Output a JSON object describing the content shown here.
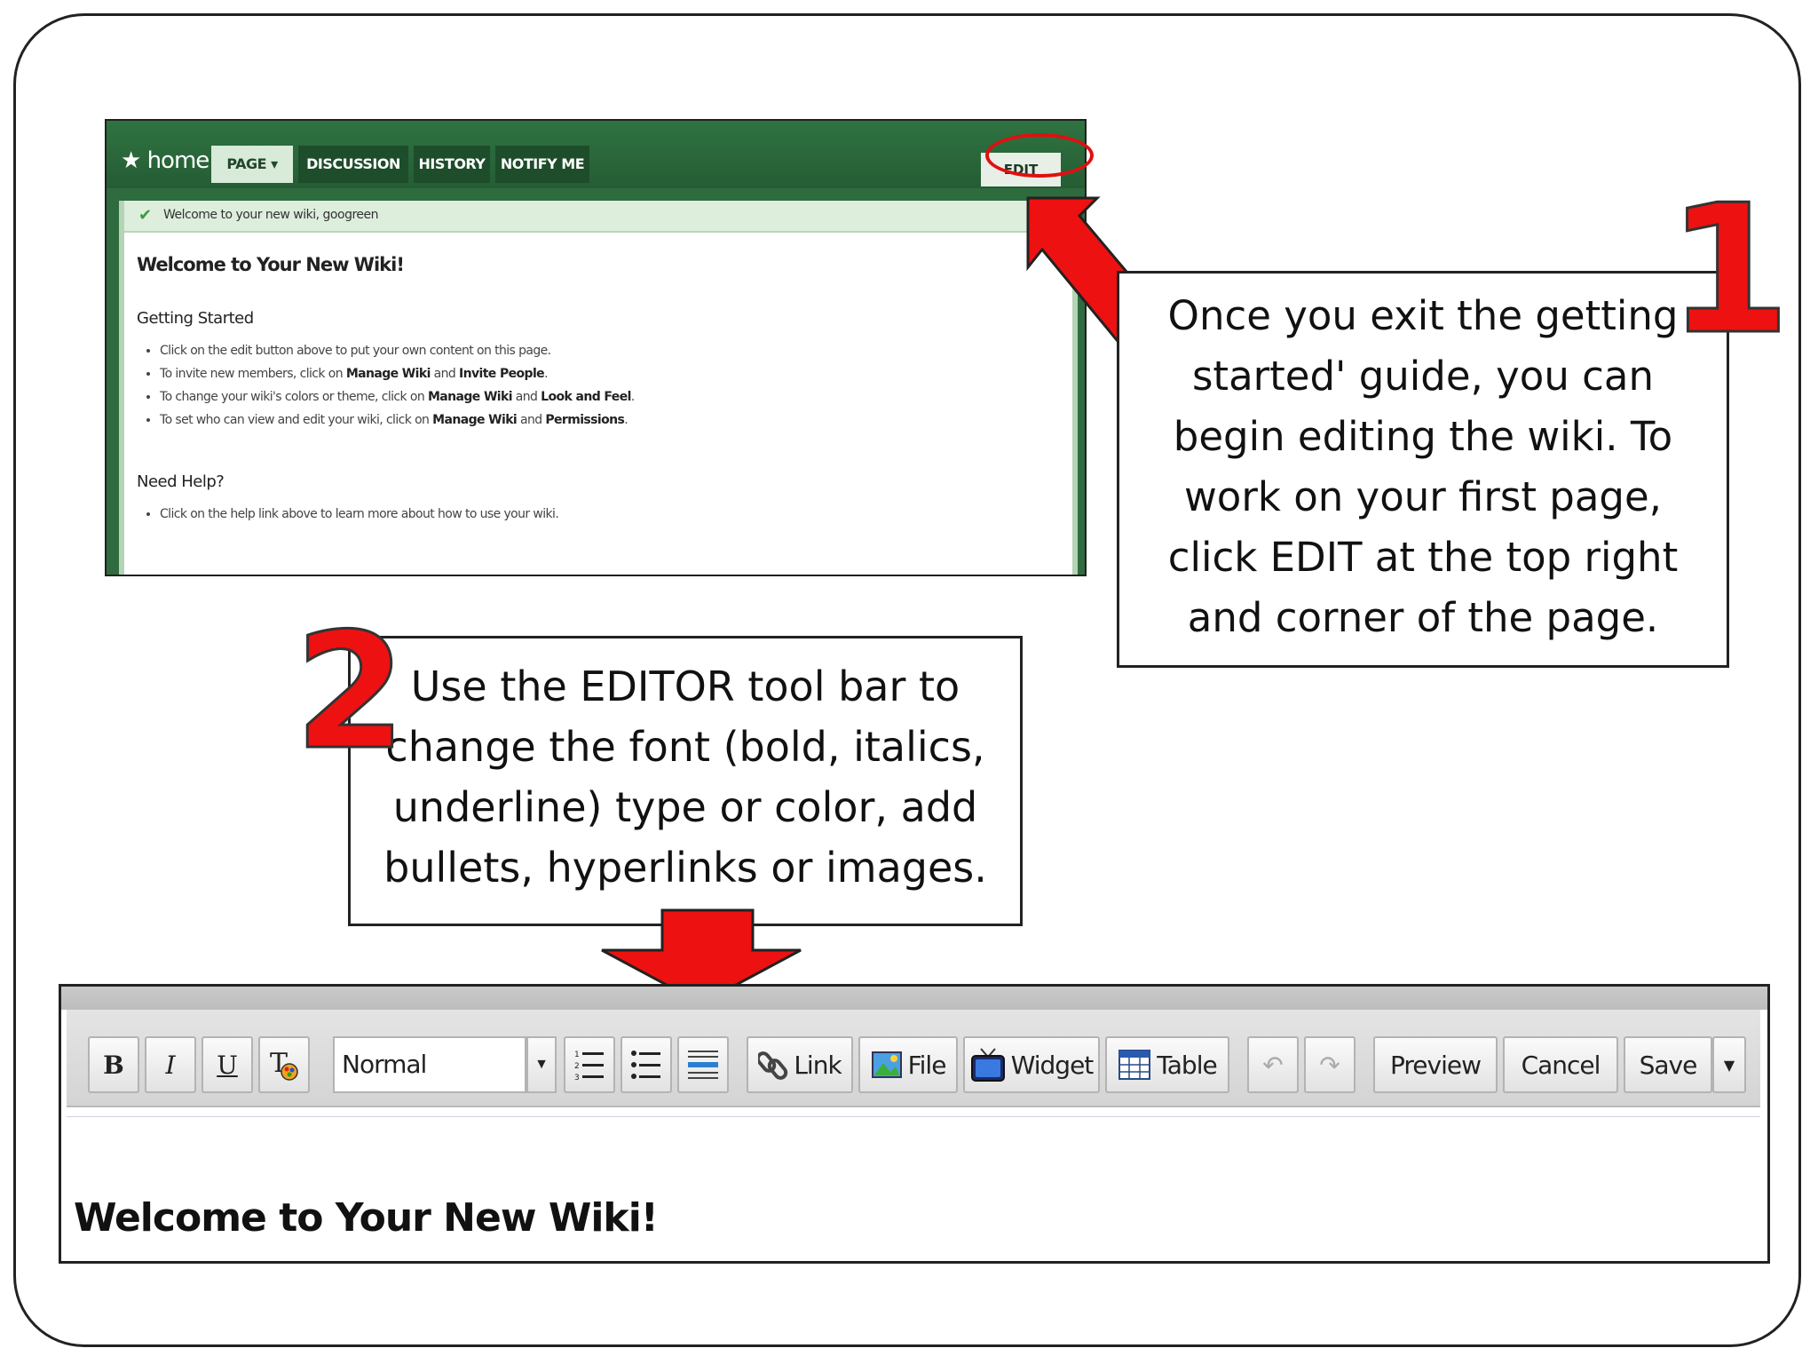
{
  "wiki": {
    "home_label": "★ home",
    "tabs": [
      {
        "label": "PAGE ▾"
      },
      {
        "label": "DISCUSSION"
      },
      {
        "label": "HISTORY"
      },
      {
        "label": "NOTIFY ME"
      }
    ],
    "edit_label": "EDIT",
    "notice": "Welcome to your new wiki, googreen",
    "title": "Welcome to Your New Wiki!",
    "getting_started": {
      "heading": "Getting Started",
      "items": [
        {
          "text": "Click on the edit button above to put your own content on this page."
        },
        {
          "pre": "To invite new members, click on ",
          "b1": "Manage Wiki",
          "mid": " and ",
          "b2": "Invite People",
          "post": "."
        },
        {
          "pre": "To change your wiki's colors or theme, click on ",
          "b1": "Manage Wiki",
          "mid": " and ",
          "b2": "Look and Feel",
          "post": "."
        },
        {
          "pre": "To set who can view and edit your wiki, click on ",
          "b1": "Manage Wiki",
          "mid": " and ",
          "b2": "Permissions",
          "post": "."
        }
      ]
    },
    "need_help": {
      "heading": "Need Help?",
      "items": [
        {
          "text": "Click on the help link above to learn more about how to use your wiki."
        }
      ]
    }
  },
  "callout1": {
    "number": "1",
    "lines": [
      "Once you exit the getting",
      "started' guide, you can",
      "begin editing the wiki. To",
      "work on your first page,",
      "click EDIT at the top right",
      "and corner of the page."
    ]
  },
  "callout2": {
    "number": "2",
    "lines": [
      "Use the EDITOR tool bar to",
      "change the font (bold, italics,",
      "underline) type or color, add",
      "bullets, hyperlinks or images."
    ]
  },
  "editor": {
    "bold": "B",
    "italic": "I",
    "underline": "U",
    "format_value": "Normal",
    "link": "Link",
    "file": "File",
    "widget": "Widget",
    "table": "Table",
    "preview": "Preview",
    "cancel": "Cancel",
    "save": "Save",
    "content_heading": "Welcome to Your New Wiki!"
  },
  "colors": {
    "arrow_red": "#ee1111",
    "wiki_green": "#2e6b3e",
    "toolbar_gray": "#d9d9d9"
  },
  "icons": [
    "star-icon",
    "chevron-down-icon",
    "check-icon",
    "text-color-icon",
    "numbered-list-icon",
    "bullet-list-icon",
    "horizontal-rule-icon",
    "link-icon",
    "image-file-icon",
    "widget-tv-icon",
    "table-icon",
    "undo-icon",
    "redo-icon",
    "arrow-up-left-icon",
    "arrow-down-icon"
  ]
}
